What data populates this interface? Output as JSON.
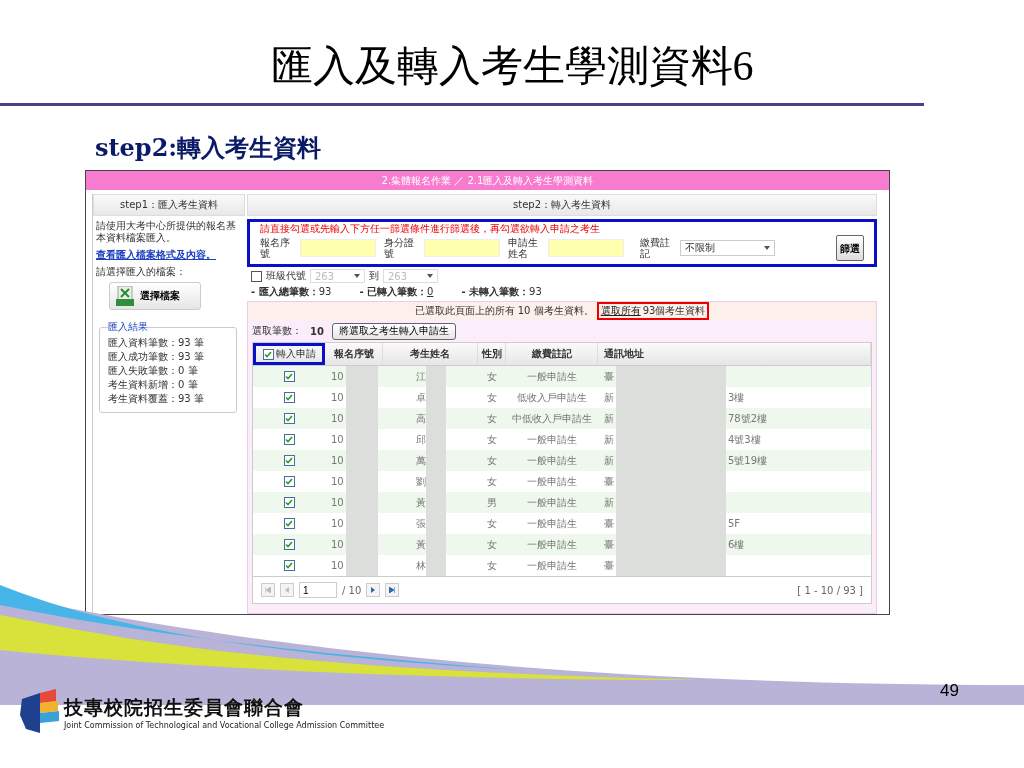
{
  "slide": {
    "title": "匯入及轉入考生學測資料6",
    "subtitle": "step2:轉入考生資料",
    "page_number": "49"
  },
  "app": {
    "breadcrumb": "2.集體報名作業 ／ 2.1匯入及轉入考生學測資料",
    "left_panel": {
      "header": "step1：匯入考生資料",
      "instructions": "請使用大考中心所提供的報名基本資料檔案匯入。",
      "format_link": "查看匯入檔案格式及內容。",
      "file_prompt": "請選擇匯入的檔案：",
      "file_button": "選擇檔案",
      "result_legend": "匯入結果",
      "result_lines": [
        "匯入資料筆數：93 筆",
        "匯入成功筆數：93 筆",
        "匯入失敗筆數：0 筆",
        "考生資料新增：0 筆",
        "考生資料覆蓋：93 筆"
      ]
    },
    "right_panel": {
      "header": "step2：轉入考生資料",
      "filter": {
        "hint": "請直接勾選或先輸入下方任一篩選條件進行篩選後，再勾選欲轉入申請之考生",
        "fields": [
          {
            "label": "報名序號"
          },
          {
            "label": "身分證號"
          },
          {
            "label": "申請生姓名"
          }
        ],
        "fee_label": "繳費註記",
        "fee_value": "不限制",
        "button": "篩選"
      },
      "class_filter": {
        "checked": false,
        "label": "班級代號",
        "from": "263",
        "to_label": "到",
        "to": "263"
      },
      "stats": [
        {
          "label": "- 匯入總筆數：",
          "value": "93",
          "underline": false
        },
        {
          "label": "- 已轉入筆數：",
          "value": "0",
          "underline": true
        },
        {
          "label": "- 未轉入筆數：",
          "value": "93",
          "underline": false
        }
      ],
      "banner": {
        "text": "已選取此頁面上的所有 10 個考生資料。",
        "link": "選取所有",
        "suffix": "93個考生資料"
      },
      "selected_count_label": "選取筆數：",
      "selected_count": "10",
      "transfer_button": "將選取之考生轉入申請生",
      "table": {
        "select_all_checked": true,
        "select_all_label": "轉入申請",
        "columns": [
          "報名序號",
          "考生姓名",
          "性別",
          "繳費註記",
          "通訊地址"
        ],
        "rows": [
          {
            "checked": true,
            "id": "10",
            "name": "江",
            "gender": "女",
            "fee": "一般申請生",
            "addr_start": "臺",
            "addr_end": ""
          },
          {
            "checked": true,
            "id": "10",
            "name": "卓",
            "gender": "女",
            "fee": "低收入戶申請生",
            "addr_start": "新",
            "addr_end": "3樓"
          },
          {
            "checked": true,
            "id": "10",
            "name": "高",
            "gender": "女",
            "fee": "中低收入戶申請生",
            "addr_start": "新",
            "addr_end": "78號2樓"
          },
          {
            "checked": true,
            "id": "10",
            "name": "邱",
            "gender": "女",
            "fee": "一般申請生",
            "addr_start": "新",
            "addr_end": "4號3樓"
          },
          {
            "checked": true,
            "id": "10",
            "name": "萬",
            "gender": "女",
            "fee": "一般申請生",
            "addr_start": "新",
            "addr_end": "5號19樓"
          },
          {
            "checked": true,
            "id": "10",
            "name": "劉",
            "gender": "女",
            "fee": "一般申請生",
            "addr_start": "臺",
            "addr_end": ""
          },
          {
            "checked": true,
            "id": "10",
            "name": "黃",
            "gender": "男",
            "fee": "一般申請生",
            "addr_start": "新",
            "addr_end": ""
          },
          {
            "checked": true,
            "id": "10",
            "name": "張",
            "gender": "女",
            "fee": "一般申請生",
            "addr_start": "臺",
            "addr_end": "5F"
          },
          {
            "checked": true,
            "id": "10",
            "name": "黃",
            "gender": "女",
            "fee": "一般申請生",
            "addr_start": "臺",
            "addr_end": "6樓"
          },
          {
            "checked": true,
            "id": "10",
            "name": "林",
            "gender": "女",
            "fee": "一般申請生",
            "addr_start": "臺",
            "addr_end": ""
          }
        ]
      },
      "pager": {
        "page": "1",
        "total": "/ 10",
        "range": "[ 1 - 10 / 93 ]"
      }
    }
  },
  "footer": {
    "org_name": "技專校院招生委員會聯合會",
    "org_english": "Joint Commission of Technological and Vocational College Admission Committee"
  }
}
